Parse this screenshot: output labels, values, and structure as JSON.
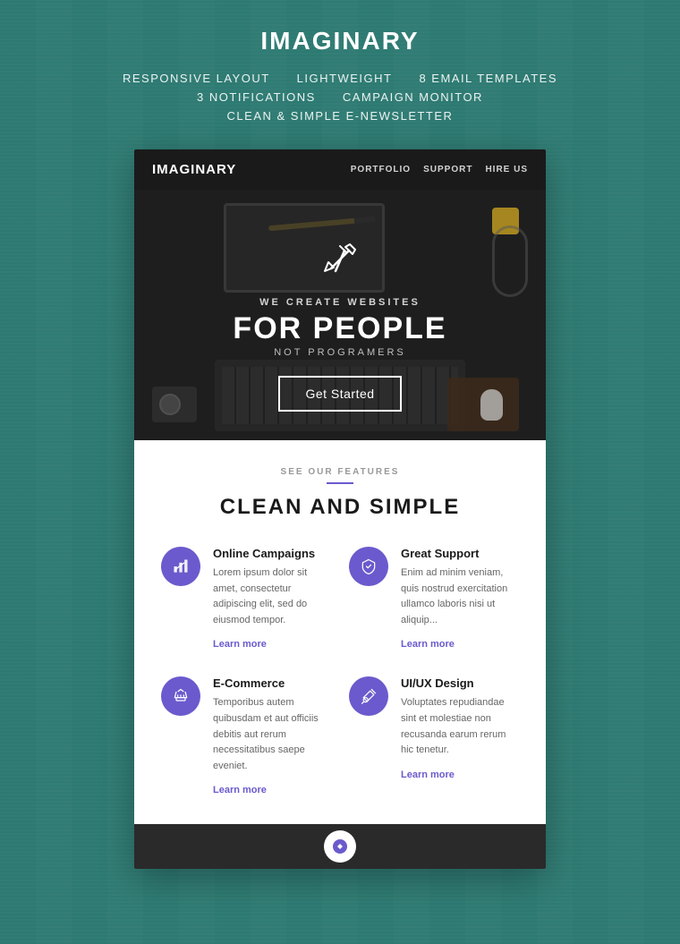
{
  "site": {
    "title": "IMAGINARY"
  },
  "header": {
    "features": [
      "RESPONSIVE LAYOUT",
      "LIGHTWEIGHT",
      "8 EMAIL TEMPLATES"
    ],
    "features_row2": [
      "3 NOTIFICATIONS",
      "CAMPAIGN MONITOR"
    ],
    "features_row3": [
      "CLEAN & SIMPLE E-NEWSLETTER"
    ]
  },
  "card": {
    "nav": {
      "logo": "IMAGINARY",
      "links": [
        {
          "label": "PORTFOLIO"
        },
        {
          "label": "SUPPORT"
        },
        {
          "label": "HIRE US"
        }
      ]
    },
    "hero": {
      "subtitle": "WE CREATE WEBSITES",
      "title": "FOR PEOPLE",
      "description": "NOT PROGRAMERS",
      "button": "Get Started"
    },
    "section": {
      "label": "SEE OUR FEATURES",
      "title": "CLEAN AND SIMPLE"
    },
    "features": [
      {
        "id": "online-campaigns",
        "title": "Online Campaigns",
        "description": "Lorem ipsum dolor sit amet, consectetur adipiscing elit, sed do eiusmod tempor.",
        "link": "Learn more",
        "icon": "chart-icon"
      },
      {
        "id": "great-support",
        "title": "Great Support",
        "description": "Enim ad minim veniam, quis nostrud exercitation ullamco laboris nisi ut aliquip...",
        "link": "Learn more",
        "icon": "shield-icon"
      },
      {
        "id": "ecommerce",
        "title": "E-Commerce",
        "description": "Temporibus autem quibusdam et aut officiis debitis aut rerum necessitatibus saepe eveniet.",
        "link": "Learn more",
        "icon": "basket-icon"
      },
      {
        "id": "uiux-design",
        "title": "UI/UX Design",
        "description": "Voluptates repudiandae sint et molestiae non recusanda earum rerum hic tenetur.",
        "link": "Learn more",
        "icon": "tools-icon"
      }
    ]
  }
}
